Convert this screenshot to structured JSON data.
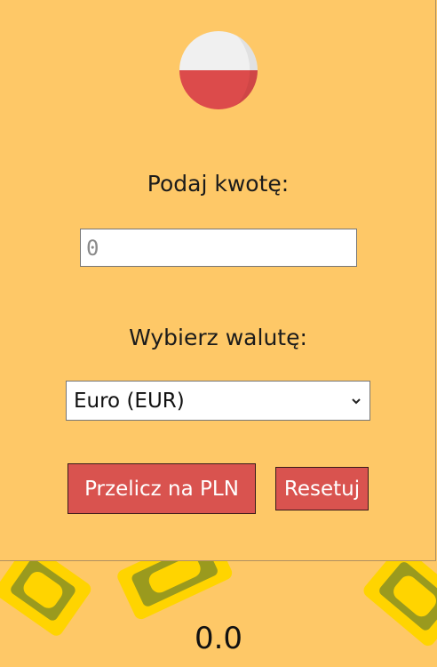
{
  "colors": {
    "background": "#fec867",
    "button": "#d9534f",
    "flag_white": "#f0f0f0",
    "flag_red": "#dc4b4b"
  },
  "icons": {
    "flag": "poland-flag-icon",
    "select_arrow": "chevron-down-icon"
  },
  "form": {
    "amount_label": "Podaj kwotę:",
    "amount_placeholder": "0",
    "amount_value": "",
    "currency_label": "Wybierz walutę:",
    "currency_selected": "Euro (EUR)"
  },
  "buttons": {
    "convert": "Przelicz na PLN",
    "reset": "Resetuj"
  },
  "result": {
    "value": "0.0"
  }
}
